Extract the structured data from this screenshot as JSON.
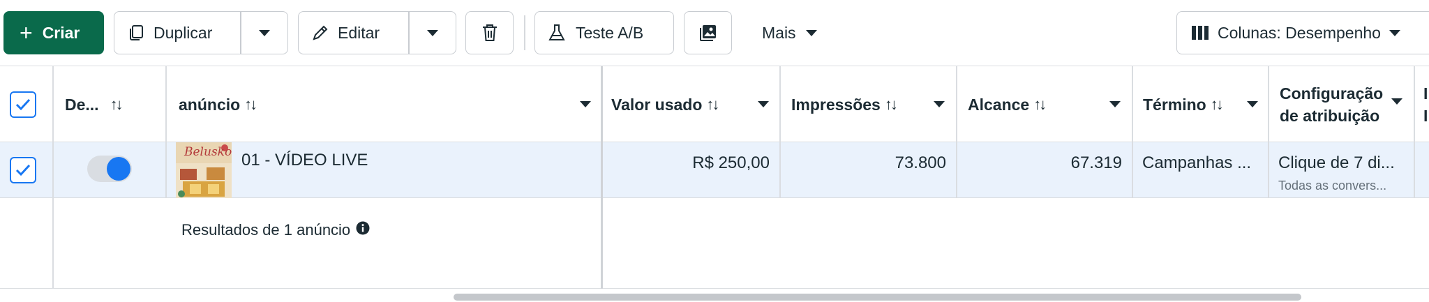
{
  "toolbar": {
    "create_label": "Criar",
    "duplicate_label": "Duplicar",
    "edit_label": "Editar",
    "ab_test_label": "Teste A/B",
    "more_label": "Mais",
    "columns_label": "Colunas: Desempenho"
  },
  "table": {
    "headers": {
      "delivery": "De...",
      "ad": "anúncio",
      "amount_spent": "Valor usado",
      "impressions": "Impressões",
      "reach": "Alcance",
      "ends": "Término",
      "attribution_line1": "Configuração",
      "attribution_line2": "de atribuição",
      "cut_off": "I"
    },
    "sort_glyph": "↑↓",
    "row": {
      "ad_name": "01 - VÍDEO LIVE",
      "amount_spent": "R$ 250,00",
      "impressions": "73.800",
      "reach": "67.319",
      "ends": "Campanhas ...",
      "attribution": "Clique de 7 di...",
      "attribution_sub": "Todas as convers...",
      "thumbnail_text": "Belusko",
      "active": true
    },
    "footer": {
      "results_label": "Resultados de 1 anúncio"
    }
  },
  "colors": {
    "primary_green": "#0a6a4b",
    "accent_blue": "#1877f2",
    "row_selected": "#eaf2fc"
  },
  "icons": [
    "plus-icon",
    "duplicate-icon",
    "pencil-icon",
    "trash-icon",
    "flask-icon",
    "image-icon",
    "columns-icon",
    "caret-down-icon",
    "sort-icon",
    "check-icon",
    "info-icon"
  ]
}
